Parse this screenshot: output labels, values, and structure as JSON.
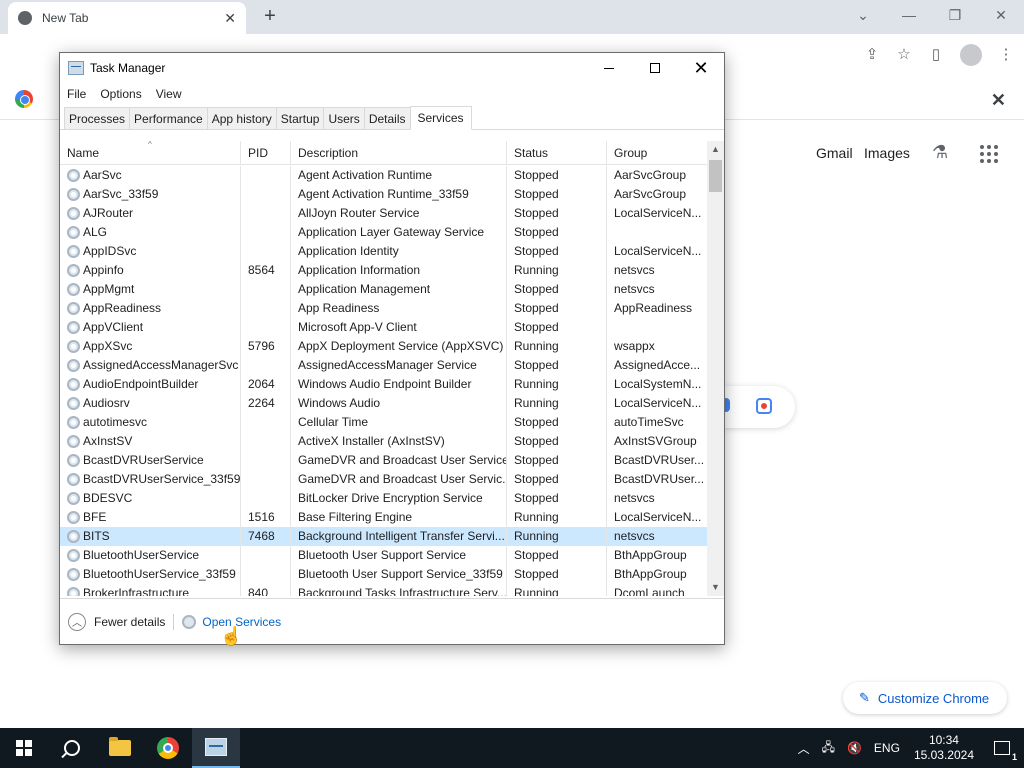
{
  "chrome": {
    "tab_title": "New Tab",
    "header_links": {
      "gmail": "Gmail",
      "images": "Images"
    },
    "customize_label": "Customize Chrome"
  },
  "task_manager": {
    "title": "Task Manager",
    "menu": [
      "File",
      "Options",
      "View"
    ],
    "tabs": [
      "Processes",
      "Performance",
      "App history",
      "Startup",
      "Users",
      "Details",
      "Services"
    ],
    "active_tab": "Services",
    "columns": {
      "name": "Name",
      "pid": "PID",
      "description": "Description",
      "status": "Status",
      "group": "Group"
    },
    "rows": [
      {
        "name": "AarSvc",
        "pid": "",
        "description": "Agent Activation Runtime",
        "status": "Stopped",
        "group": "AarSvcGroup"
      },
      {
        "name": "AarSvc_33f59",
        "pid": "",
        "description": "Agent Activation Runtime_33f59",
        "status": "Stopped",
        "group": "AarSvcGroup"
      },
      {
        "name": "AJRouter",
        "pid": "",
        "description": "AllJoyn Router Service",
        "status": "Stopped",
        "group": "LocalServiceN..."
      },
      {
        "name": "ALG",
        "pid": "",
        "description": "Application Layer Gateway Service",
        "status": "Stopped",
        "group": ""
      },
      {
        "name": "AppIDSvc",
        "pid": "",
        "description": "Application Identity",
        "status": "Stopped",
        "group": "LocalServiceN..."
      },
      {
        "name": "Appinfo",
        "pid": "8564",
        "description": "Application Information",
        "status": "Running",
        "group": "netsvcs"
      },
      {
        "name": "AppMgmt",
        "pid": "",
        "description": "Application Management",
        "status": "Stopped",
        "group": "netsvcs"
      },
      {
        "name": "AppReadiness",
        "pid": "",
        "description": "App Readiness",
        "status": "Stopped",
        "group": "AppReadiness"
      },
      {
        "name": "AppVClient",
        "pid": "",
        "description": "Microsoft App-V Client",
        "status": "Stopped",
        "group": ""
      },
      {
        "name": "AppXSvc",
        "pid": "5796",
        "description": "AppX Deployment Service (AppXSVC)",
        "status": "Running",
        "group": "wsappx"
      },
      {
        "name": "AssignedAccessManagerSvc",
        "pid": "",
        "description": "AssignedAccessManager Service",
        "status": "Stopped",
        "group": "AssignedAcce..."
      },
      {
        "name": "AudioEndpointBuilder",
        "pid": "2064",
        "description": "Windows Audio Endpoint Builder",
        "status": "Running",
        "group": "LocalSystemN..."
      },
      {
        "name": "Audiosrv",
        "pid": "2264",
        "description": "Windows Audio",
        "status": "Running",
        "group": "LocalServiceN..."
      },
      {
        "name": "autotimesvc",
        "pid": "",
        "description": "Cellular Time",
        "status": "Stopped",
        "group": "autoTimeSvc"
      },
      {
        "name": "AxInstSV",
        "pid": "",
        "description": "ActiveX Installer (AxInstSV)",
        "status": "Stopped",
        "group": "AxInstSVGroup"
      },
      {
        "name": "BcastDVRUserService",
        "pid": "",
        "description": "GameDVR and Broadcast User Service",
        "status": "Stopped",
        "group": "BcastDVRUser..."
      },
      {
        "name": "BcastDVRUserService_33f59",
        "pid": "",
        "description": "GameDVR and Broadcast User Servic...",
        "status": "Stopped",
        "group": "BcastDVRUser..."
      },
      {
        "name": "BDESVC",
        "pid": "",
        "description": "BitLocker Drive Encryption Service",
        "status": "Stopped",
        "group": "netsvcs"
      },
      {
        "name": "BFE",
        "pid": "1516",
        "description": "Base Filtering Engine",
        "status": "Running",
        "group": "LocalServiceN..."
      },
      {
        "name": "BITS",
        "pid": "7468",
        "description": "Background Intelligent Transfer Servi...",
        "status": "Running",
        "group": "netsvcs",
        "selected": true
      },
      {
        "name": "BluetoothUserService",
        "pid": "",
        "description": "Bluetooth User Support Service",
        "status": "Stopped",
        "group": "BthAppGroup"
      },
      {
        "name": "BluetoothUserService_33f59",
        "pid": "",
        "description": "Bluetooth User Support Service_33f59",
        "status": "Stopped",
        "group": "BthAppGroup"
      },
      {
        "name": "BrokerInfrastructure",
        "pid": "840",
        "description": "Background Tasks Infrastructure Serv...",
        "status": "Running",
        "group": "DcomLaunch"
      }
    ],
    "footer": {
      "fewer_details": "Fewer details",
      "open_services": "Open Services"
    }
  },
  "taskbar": {
    "language": "ENG",
    "time": "10:34",
    "date": "15.03.2024",
    "notifications": "1"
  }
}
